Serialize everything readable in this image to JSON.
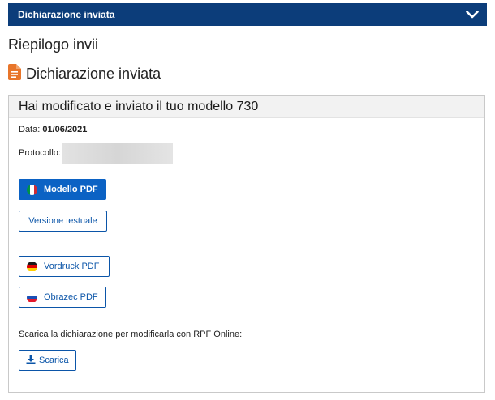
{
  "header": {
    "title": "Dichiarazione inviata",
    "toggle_icon": "chevron-down-icon"
  },
  "section_title": "Riepilogo invii",
  "subsection": {
    "icon": "document-icon",
    "title": "Dichiarazione inviata"
  },
  "panel": {
    "title": "Hai modificato e inviato il tuo modello 730",
    "data_label": "Data:",
    "data_value": "01/06/2021",
    "protocollo_label": "Protocollo:"
  },
  "buttons": {
    "modello_pdf": "Modello PDF",
    "versione_testuale": "Versione testuale",
    "vordruck_pdf": "Vordruck PDF",
    "obrazec_pdf": "Obrazec PDF",
    "scarica": "Scarica"
  },
  "download_text": "Scarica la dichiarazione per modificarla con RPF Online:",
  "colors": {
    "header_bg": "#0c3d7a",
    "primary": "#0b62c4",
    "link": "#0b55a8",
    "doc_icon": "#e8752a"
  }
}
